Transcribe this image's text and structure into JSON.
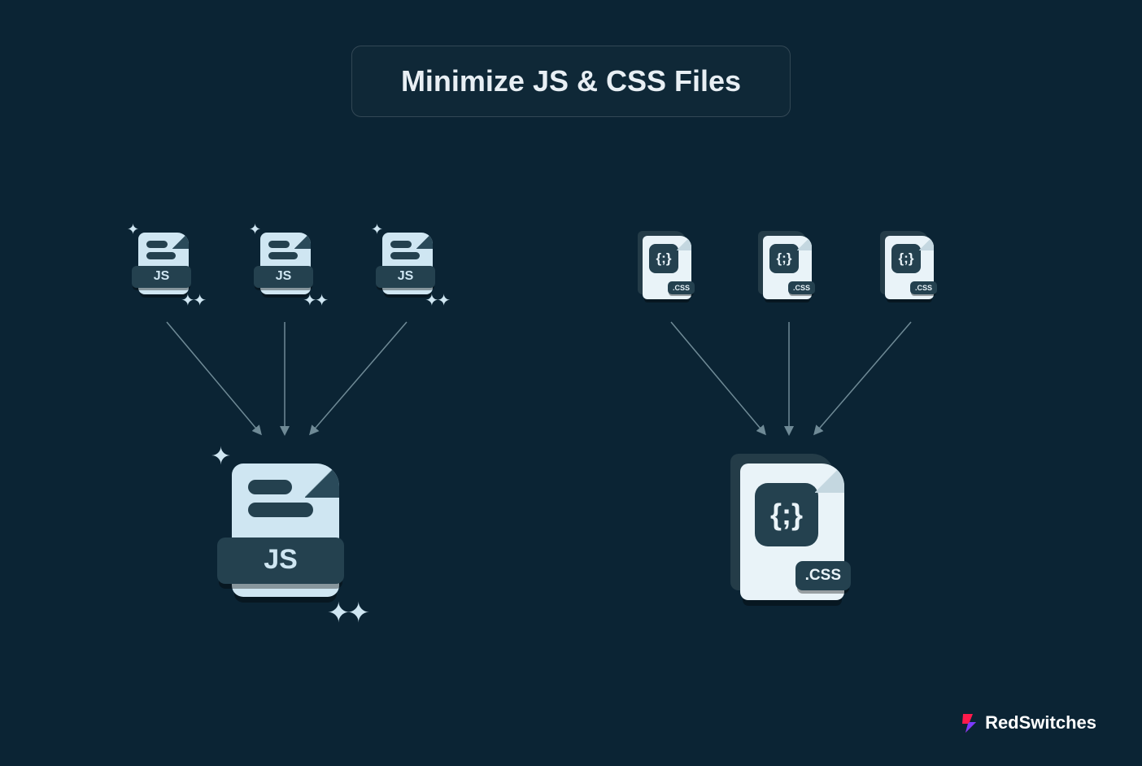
{
  "header": {
    "title": "Minimize JS & CSS Files"
  },
  "labels": {
    "js_small": "JS",
    "js_big": "JS",
    "css_ext_small": ".CSS",
    "css_ext_big": ".CSS",
    "css_braces": "{;}"
  },
  "logo": {
    "brand": "RedSwitches"
  },
  "colors": {
    "bg": "#0b2434",
    "doc_light": "#cfe6f2",
    "doc_dark": "#24414f",
    "css_paper": "#e9f3f8",
    "logo_red": "#ff1a4b",
    "logo_purple": "#7a3bff"
  }
}
